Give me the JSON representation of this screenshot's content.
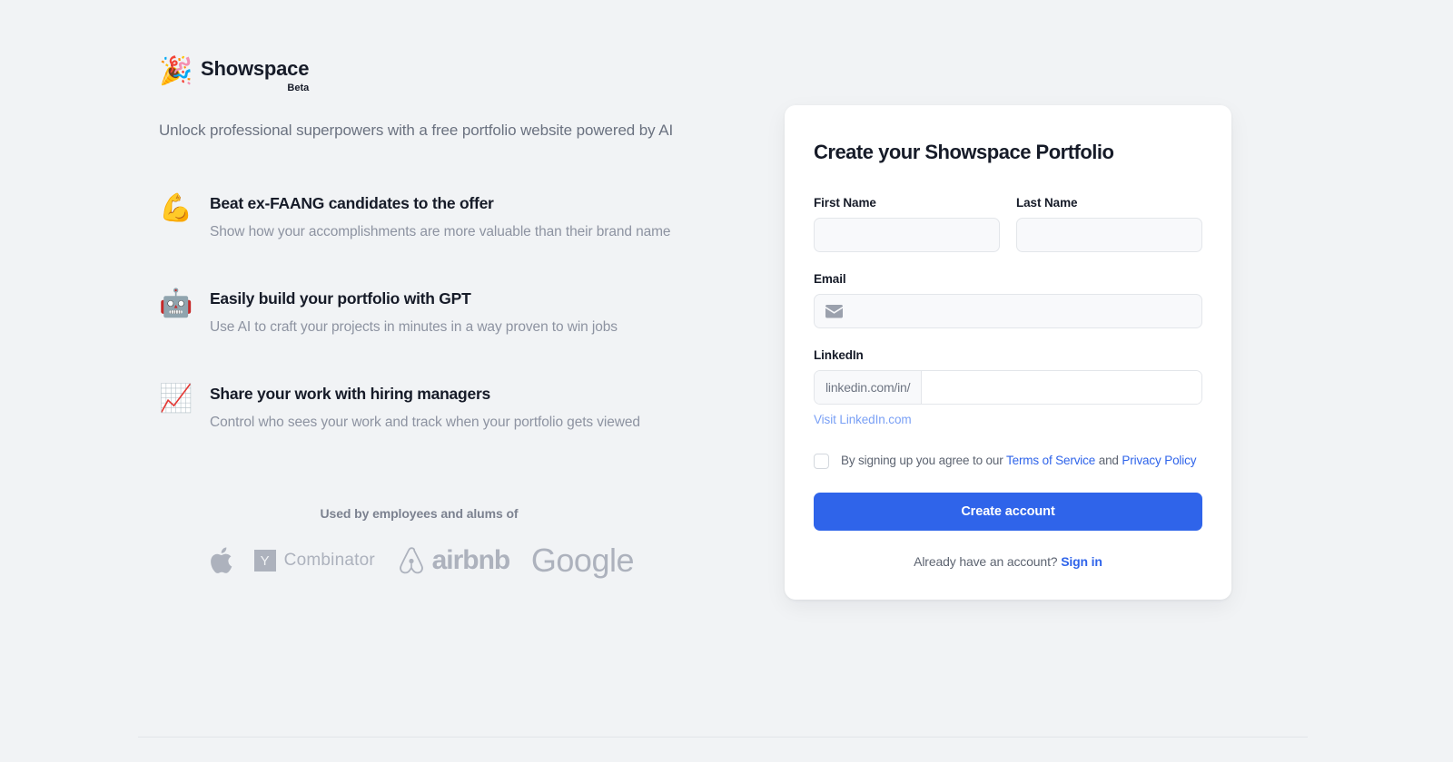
{
  "brand": {
    "emoji": "🎉",
    "icon_name": "party-popper-icon",
    "name": "Showspace",
    "badge": "Beta",
    "tagline": "Unlock professional superpowers with a free portfolio website powered by AI"
  },
  "features": [
    {
      "emoji": "💪",
      "icon_name": "flexed-biceps-icon",
      "title": "Beat ex-FAANG candidates to the offer",
      "desc": "Show how your accomplishments are more valuable than their brand name"
    },
    {
      "emoji": "🤖",
      "icon_name": "robot-icon",
      "title": "Easily build your portfolio with GPT",
      "desc": "Use AI to craft your projects in minutes in a way proven to win jobs"
    },
    {
      "emoji": "📈",
      "icon_name": "chart-increasing-icon",
      "title": "Share your work with hiring managers",
      "desc": "Control who sees your work and track when your portfolio gets viewed"
    }
  ],
  "social_proof": {
    "heading": "Used by employees and alums of",
    "logos": [
      {
        "name": "apple",
        "label": ""
      },
      {
        "name": "y-combinator",
        "mark": "Y",
        "label": "Combinator"
      },
      {
        "name": "airbnb",
        "label": "airbnb"
      },
      {
        "name": "google",
        "label": "Google"
      }
    ]
  },
  "form": {
    "title": "Create your Showspace Portfolio",
    "first_name": {
      "label": "First Name",
      "value": "",
      "placeholder": ""
    },
    "last_name": {
      "label": "Last Name",
      "value": "",
      "placeholder": ""
    },
    "email": {
      "label": "Email",
      "value": "",
      "placeholder": "",
      "icon": "envelope-icon"
    },
    "linkedin": {
      "label": "LinkedIn",
      "prefix": "linkedin.com/in/",
      "value": "",
      "placeholder": "",
      "visit_link": "Visit LinkedIn.com"
    },
    "terms": {
      "checked": false,
      "prefix": "By signing up you agree to our",
      "terms_link": "Terms of Service",
      "conjunction": "and",
      "privacy_link": "Privacy Policy"
    },
    "submit_label": "Create account",
    "signin_prompt": "Already have an account?",
    "signin_link": "Sign in"
  },
  "colors": {
    "background": "#f1f3f5",
    "card": "#ffffff",
    "accent": "#2f64ea",
    "heading": "#161b28",
    "muted": "#8d93a1",
    "logo_gray": "#adb2bd",
    "link_light": "#7aa0f5"
  }
}
